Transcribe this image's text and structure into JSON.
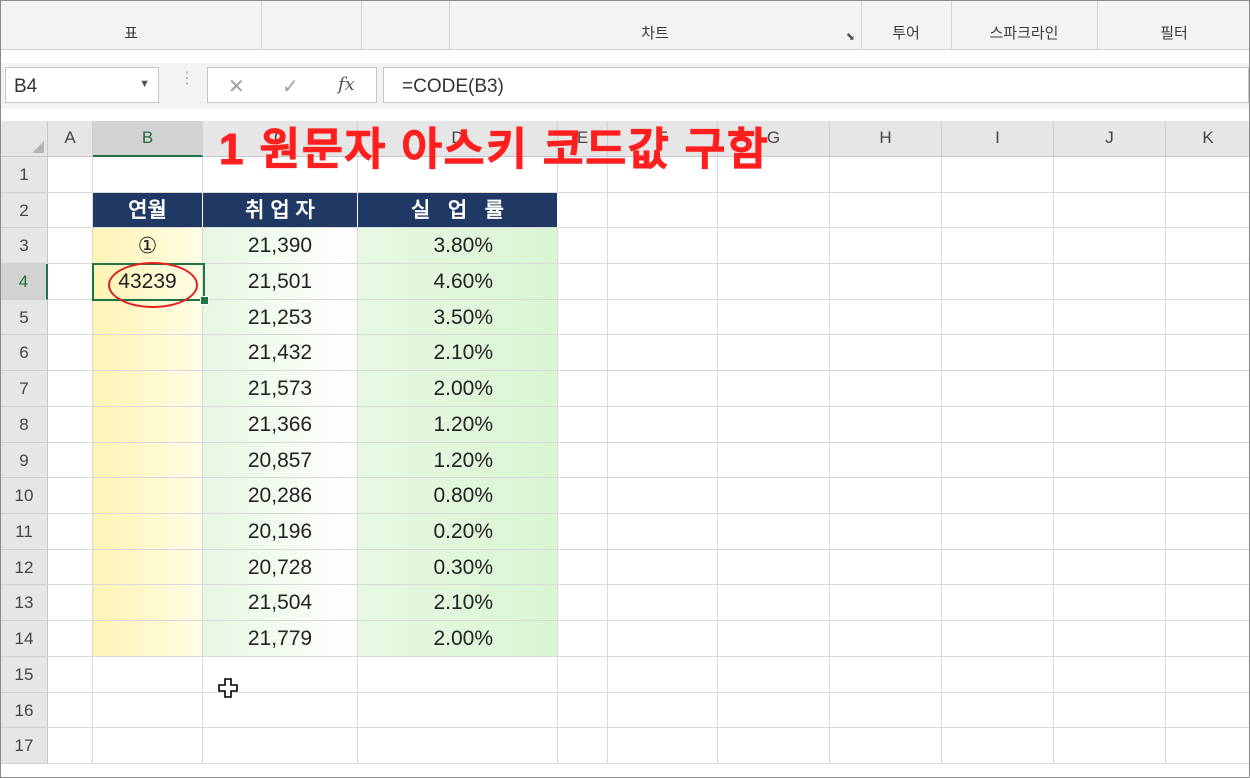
{
  "ribbon": {
    "groups": [
      {
        "label": "표"
      },
      {
        "label": ""
      },
      {
        "label": ""
      },
      {
        "label": "차트"
      },
      {
        "label": "투어"
      },
      {
        "label": "스파크라인"
      },
      {
        "label": "필터"
      }
    ]
  },
  "formula_bar": {
    "name_box": "B4",
    "cancel_icon": "✕",
    "enter_icon": "✓",
    "fx_icon": "fx",
    "formula": "=CODE(B3)"
  },
  "columns": [
    "A",
    "B",
    "C",
    "D",
    "E",
    "F",
    "G",
    "H",
    "I",
    "J",
    "K"
  ],
  "rows": [
    "1",
    "2",
    "3",
    "4",
    "5",
    "6",
    "7",
    "8",
    "9",
    "10",
    "11",
    "12",
    "13",
    "14",
    "15",
    "16",
    "17"
  ],
  "table": {
    "headers": [
      "연월",
      "취 업 자",
      "실   업   률"
    ],
    "b_values": [
      "①",
      "43239"
    ],
    "c_values": [
      "21,390",
      "21,501",
      "21,253",
      "21,432",
      "21,573",
      "21,366",
      "20,857",
      "20,286",
      "20,196",
      "20,728",
      "21,504",
      "21,779"
    ],
    "d_values": [
      "3.80%",
      "4.60%",
      "3.50%",
      "2.10%",
      "2.00%",
      "1.20%",
      "1.20%",
      "0.80%",
      "0.20%",
      "0.30%",
      "2.10%",
      "2.00%"
    ]
  },
  "annotation": "1 원문자 아스키 코드값 구함",
  "colors": {
    "header_bg": "#1f3864",
    "selection": "#217346",
    "annotation": "#ff1f1f"
  }
}
